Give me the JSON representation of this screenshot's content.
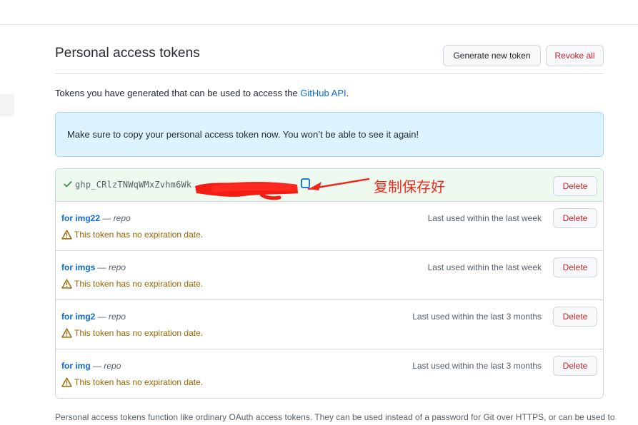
{
  "header": {
    "title": "Personal access tokens",
    "generate_label": "Generate new token",
    "revoke_label": "Revoke all"
  },
  "intro": {
    "text": "Tokens you have generated that can be used to access the ",
    "link": "GitHub API",
    "suffix": "."
  },
  "flash": {
    "message": "Make sure to copy your personal access token now. You won’t be able to see it again!"
  },
  "new_token": {
    "visible_prefix": "ghp_CRlzTNWqWMxZvhm6Wk",
    "delete_label": "Delete",
    "annotation": "复制保存好",
    "icons": [
      "check-icon",
      "copy-icon"
    ],
    "annotation_color": "#f0291d"
  },
  "tokens": [
    {
      "name": "for img22",
      "dash": " — ",
      "scope": "repo",
      "last_used": "Last used within the last week",
      "warning": "This token has no expiration date.",
      "delete_label": "Delete"
    },
    {
      "name": "for imgs",
      "dash": " — ",
      "scope": "repo",
      "last_used": "Last used within the last week",
      "warning": "This token has no expiration date.",
      "delete_label": "Delete"
    },
    {
      "name": "for img2",
      "dash": " — ",
      "scope": "repo",
      "last_used": "Last used within the last 3 months",
      "warning": "This token has no expiration date.",
      "delete_label": "Delete"
    },
    {
      "name": "for img",
      "dash": " — ",
      "scope": "repo",
      "last_used": "Last used within the last 3 months",
      "warning": "This token has no expiration date.",
      "delete_label": "Delete"
    }
  ],
  "footer": {
    "text": "Personal access tokens function like ordinary OAuth access tokens. They can be used instead of a password for Git over HTTPS, or can be used to"
  },
  "colors": {
    "link": "#0969da",
    "danger": "#cf222e",
    "warning": "#9a6700",
    "flash_bg": "#ddf4ff",
    "new_token_bg": "#eefaef"
  }
}
